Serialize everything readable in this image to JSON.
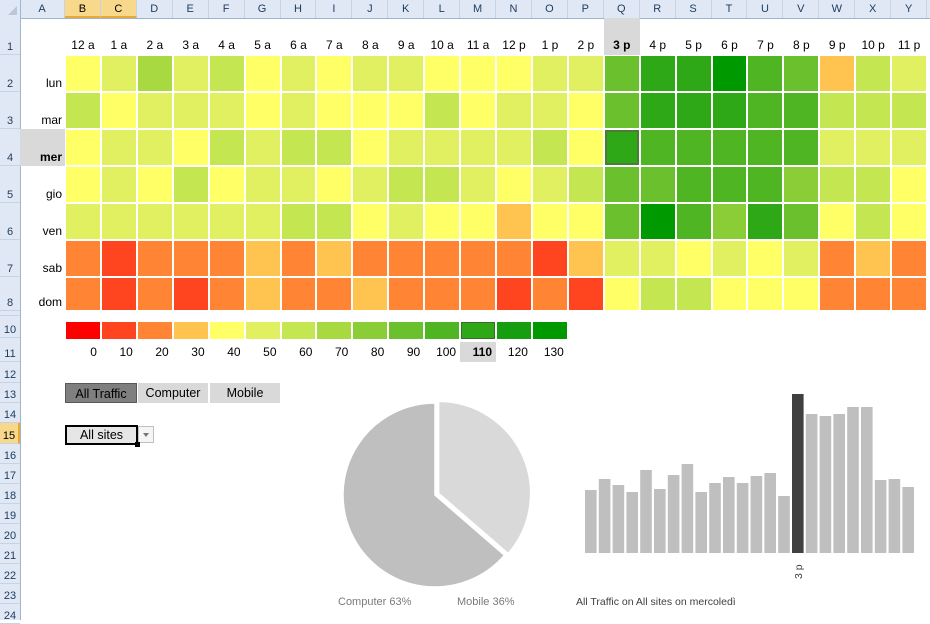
{
  "sheet": {
    "columns": [
      "A",
      "B",
      "C",
      "D",
      "E",
      "F",
      "G",
      "H",
      "I",
      "J",
      "K",
      "L",
      "M",
      "N",
      "O",
      "P",
      "Q",
      "R",
      "S",
      "T",
      "U",
      "V",
      "W",
      "X",
      "Y"
    ],
    "selected_columns": [
      "B",
      "C"
    ],
    "rows": [
      "1",
      "2",
      "3",
      "4",
      "5",
      "6",
      "7",
      "8",
      "9",
      "10",
      "11",
      "12",
      "13",
      "14",
      "15",
      "16",
      "17",
      "18",
      "19",
      "20",
      "21",
      "22",
      "23",
      "24"
    ],
    "selected_row": "15"
  },
  "heatmap": {
    "hours": [
      "12 a",
      "1 a",
      "2 a",
      "3 a",
      "4 a",
      "5 a",
      "6 a",
      "7 a",
      "8 a",
      "9 a",
      "10 a",
      "11 a",
      "12 p",
      "1 p",
      "2 p",
      "3 p",
      "4 p",
      "5 p",
      "6 p",
      "7 p",
      "8 p",
      "9 p",
      "10 p",
      "11 p"
    ],
    "selected_hour_index": 15,
    "days": [
      "lun",
      "mar",
      "mer",
      "gio",
      "ven",
      "sab",
      "dom"
    ],
    "selected_day_index": 2,
    "values": [
      [
        40,
        50,
        70,
        50,
        60,
        40,
        50,
        40,
        50,
        50,
        40,
        40,
        40,
        50,
        50,
        90,
        110,
        110,
        130,
        100,
        90,
        30,
        60,
        50
      ],
      [
        60,
        40,
        50,
        50,
        50,
        40,
        50,
        40,
        40,
        40,
        60,
        40,
        50,
        50,
        40,
        90,
        110,
        110,
        110,
        100,
        100,
        60,
        60,
        60
      ],
      [
        40,
        50,
        50,
        40,
        60,
        50,
        60,
        60,
        40,
        50,
        50,
        50,
        50,
        60,
        40,
        110,
        100,
        100,
        100,
        100,
        100,
        50,
        50,
        50
      ],
      [
        40,
        50,
        40,
        60,
        40,
        50,
        50,
        40,
        50,
        60,
        60,
        50,
        40,
        50,
        60,
        90,
        90,
        100,
        100,
        100,
        80,
        60,
        60,
        40
      ],
      [
        50,
        50,
        50,
        50,
        50,
        50,
        60,
        60,
        40,
        50,
        40,
        40,
        30,
        40,
        40,
        90,
        130,
        100,
        80,
        110,
        90,
        40,
        60,
        40
      ],
      [
        20,
        10,
        20,
        20,
        20,
        30,
        20,
        30,
        20,
        20,
        20,
        20,
        20,
        10,
        30,
        50,
        50,
        40,
        50,
        40,
        50,
        20,
        30,
        20
      ],
      [
        20,
        10,
        20,
        10,
        20,
        30,
        20,
        20,
        30,
        20,
        20,
        20,
        10,
        20,
        10,
        40,
        60,
        60,
        40,
        40,
        40,
        20,
        20,
        20
      ]
    ]
  },
  "legend": {
    "values": [
      0,
      10,
      20,
      30,
      40,
      50,
      60,
      70,
      80,
      90,
      100,
      110,
      120,
      130
    ],
    "labels": [
      "0",
      "10",
      "20",
      "30",
      "40",
      "50",
      "60",
      "70",
      "80",
      "90",
      "100",
      "110",
      "120",
      "130"
    ],
    "colors": [
      "#ff0000",
      "#ff451f",
      "#ff8433",
      "#ffc34f",
      "#ffff66",
      "#e0f060",
      "#c4e650",
      "#a8d941",
      "#8bcd36",
      "#6bc12d",
      "#4fb522",
      "#2fa818",
      "#169e10",
      "#009900"
    ],
    "selected_index": 11
  },
  "filters": {
    "buttons": [
      {
        "label": "All Traffic",
        "active": true
      },
      {
        "label": "Computer",
        "active": false
      },
      {
        "label": "Mobile",
        "active": false
      }
    ],
    "site_dropdown": {
      "value": "All sites"
    }
  },
  "chart_data": [
    {
      "type": "pie",
      "title": "",
      "labels": [
        "Computer",
        "Mobile"
      ],
      "values": [
        63,
        36
      ],
      "data_labels": [
        "Computer 63%",
        "Mobile 36%"
      ],
      "colors": [
        "#bfbfbf",
        "#d9d9d9"
      ],
      "exploded": "Mobile"
    },
    {
      "type": "bar",
      "title": "All Traffic on  All sites on  mercoledì",
      "categories": [
        "12 a",
        "1 a",
        "2 a",
        "3 a",
        "4 a",
        "5 a",
        "6 a",
        "7 a",
        "8 a",
        "9 a",
        "10 a",
        "11 a",
        "12 p",
        "1 p",
        "2 p",
        "3 p",
        "4 p",
        "5 p",
        "6 p",
        "7 p",
        "8 p",
        "9 p",
        "10 p",
        "11 p"
      ],
      "values": [
        63,
        74,
        68,
        61,
        83,
        64,
        78,
        89,
        61,
        70,
        76,
        70,
        77,
        80,
        57,
        159,
        139,
        137,
        139,
        146,
        146,
        73,
        74,
        66
      ],
      "highlighted_category": "3 p",
      "tick_labels_shown": [
        "3 p"
      ],
      "colors": {
        "bar": "#bfbfbf",
        "highlight": "#404040"
      },
      "ylim": [
        0,
        160
      ],
      "xlabel": "",
      "ylabel": ""
    }
  ]
}
